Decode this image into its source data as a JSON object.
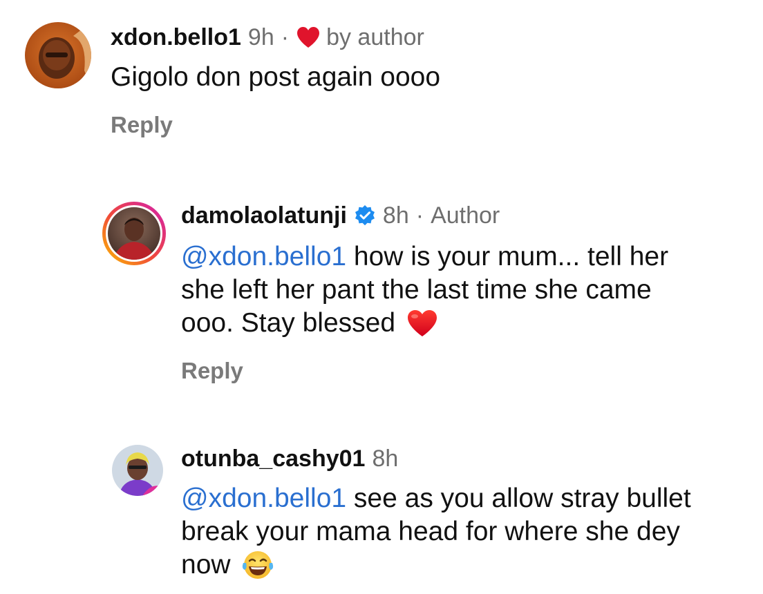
{
  "comments": [
    {
      "username": "xdon.bello1",
      "time": "9h",
      "separator": "·",
      "liked_label": "by author",
      "text": "Gigolo don post again oooo",
      "reply_label": "Reply",
      "avatar": "avatar-photo"
    },
    {
      "username": "damolaolatunji",
      "verified": true,
      "time": "8h",
      "separator": "·",
      "author_tag": "Author",
      "mention": "@xdon.bello1",
      "text_line1": " how is your mum... tell her",
      "text_line2": "she left her pant the last time she came",
      "text_line3": "ooo. Stay blessed",
      "emoji": "red-heart",
      "reply_label": "Reply",
      "avatar": "avatar-photo-story-ring"
    },
    {
      "username": "otunba_cashy01",
      "time": "8h",
      "mention": "@xdon.bello1",
      "text_line1": " see as you allow stray bullet",
      "text_line2": "break your mama head for where she dey",
      "text_line3": "now",
      "emoji": "tears-of-joy",
      "avatar": "avatar-photo"
    }
  ],
  "colors": {
    "mention": "#2a6fd0",
    "meta_grey": "#6e6e6e",
    "reply_grey": "#7a7a7a",
    "heart_red": "#e0142c",
    "verified_blue": "#1d8cf0"
  }
}
